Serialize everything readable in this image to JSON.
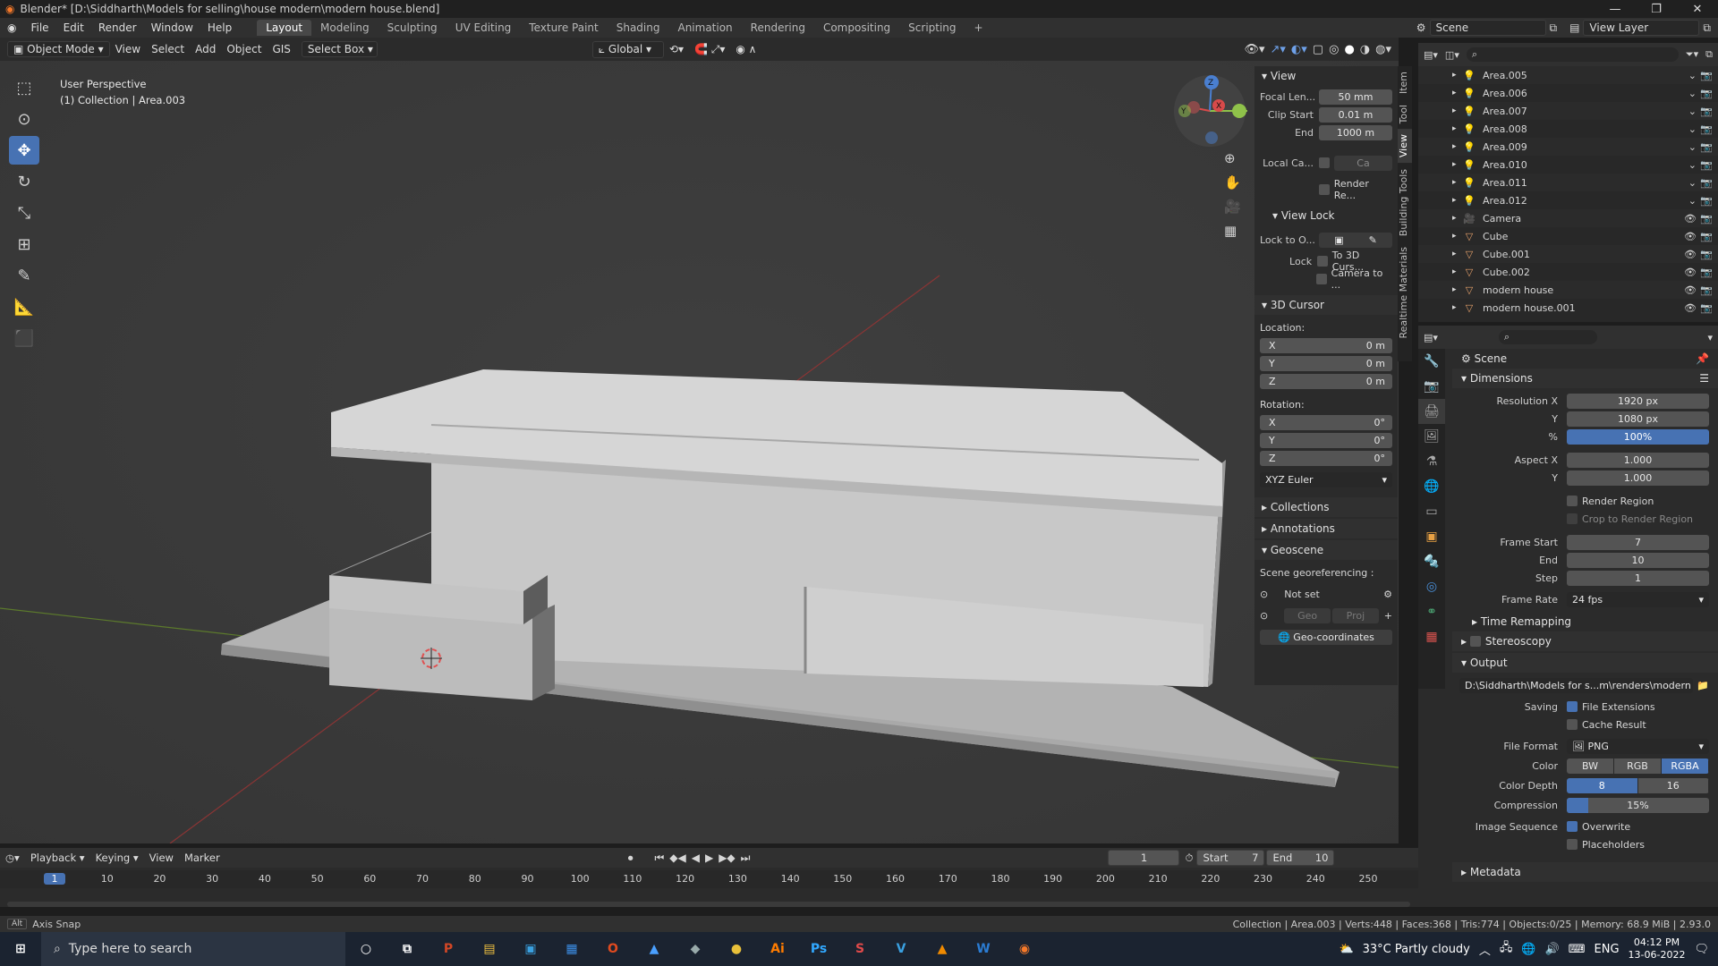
{
  "window": {
    "title": "Blender* [D:\\Siddharth\\Models for selling\\house modern\\modern house.blend]"
  },
  "menus": [
    "File",
    "Edit",
    "Render",
    "Window",
    "Help"
  ],
  "workspaces": [
    "Layout",
    "Modeling",
    "Sculpting",
    "UV Editing",
    "Texture Paint",
    "Shading",
    "Animation",
    "Rendering",
    "Compositing",
    "Scripting"
  ],
  "scene": {
    "label": "Scene",
    "view_layer": "View Layer"
  },
  "vp_header": {
    "mode": "Object Mode",
    "view": "View",
    "select": "Select",
    "add": "Add",
    "object": "Object",
    "gis": "GIS",
    "select_box": "Select Box",
    "orientation": "Global"
  },
  "vp_info": {
    "line1": "User Perspective",
    "line2": "(1) Collection | Area.003"
  },
  "npanel": {
    "view_header": "View",
    "focal_label": "Focal Len...",
    "focal": "50 mm",
    "clip_start_label": "Clip Start",
    "clip_start": "0.01 m",
    "end_label": "End",
    "end": "1000 m",
    "local_cam_label": "Local Ca...",
    "local_cam_val": "Ca",
    "render_region": "Render Re...",
    "view_lock": "View Lock",
    "lock_to": "Lock to O...",
    "lock": "Lock",
    "to_3d_cursor": "To 3D Curs...",
    "camera_to": "Camera to ...",
    "cursor_header": "3D Cursor",
    "location": "Location:",
    "x": "X",
    "y": "Y",
    "z": "Z",
    "loc_x": "0 m",
    "loc_y": "0 m",
    "loc_z": "0 m",
    "rotation": "Rotation:",
    "rot_x": "0°",
    "rot_y": "0°",
    "rot_z": "0°",
    "euler": "XYZ Euler",
    "collections": "Collections",
    "annotations": "Annotations",
    "geoscene": "Geoscene",
    "geo_label": "Scene georeferencing :",
    "not_set": "Not set",
    "geo": "Geo",
    "proj": "Proj",
    "geo_coords": "Geo-coordinates"
  },
  "ntabs": [
    "Item",
    "Tool",
    "View",
    "Building Tools",
    "Realtime Materials"
  ],
  "outliner": [
    {
      "name": "Area.005",
      "type": "light"
    },
    {
      "name": "Area.006",
      "type": "light"
    },
    {
      "name": "Area.007",
      "type": "light"
    },
    {
      "name": "Area.008",
      "type": "light"
    },
    {
      "name": "Area.009",
      "type": "light"
    },
    {
      "name": "Area.010",
      "type": "light"
    },
    {
      "name": "Area.011",
      "type": "light"
    },
    {
      "name": "Area.012",
      "type": "light"
    },
    {
      "name": "Camera",
      "type": "camera"
    },
    {
      "name": "Cube",
      "type": "mesh"
    },
    {
      "name": "Cube.001",
      "type": "mesh"
    },
    {
      "name": "Cube.002",
      "type": "mesh"
    },
    {
      "name": "modern house",
      "type": "mesh"
    },
    {
      "name": "modern house.001",
      "type": "mesh"
    }
  ],
  "props": {
    "scene": "Scene",
    "dimensions": "Dimensions",
    "res_x_label": "Resolution X",
    "res_x": "1920 px",
    "y_label": "Y",
    "res_y": "1080 px",
    "pct_label": "%",
    "pct": "100%",
    "aspect_x_label": "Aspect X",
    "aspect_x": "1.000",
    "aspect_y": "1.000",
    "render_region": "Render Region",
    "crop": "Crop to Render Region",
    "frame_start_label": "Frame Start",
    "frame_start": "7",
    "end_label": "End",
    "frame_end": "10",
    "step_label": "Step",
    "step": "1",
    "frame_rate_label": "Frame Rate",
    "frame_rate": "24 fps",
    "time_remap": "Time Remapping",
    "stereoscopy": "Stereoscopy",
    "output": "Output",
    "output_path": "D:\\Siddharth\\Models for s...m\\renders\\modern house",
    "saving": "Saving",
    "file_ext": "File Extensions",
    "cache": "Cache Result",
    "file_format_label": "File Format",
    "file_format": "PNG",
    "color_label": "Color",
    "bw": "BW",
    "rgb": "RGB",
    "rgba": "RGBA",
    "depth_label": "Color Depth",
    "d8": "8",
    "d16": "16",
    "compression_label": "Compression",
    "compression": "15%",
    "compression_fraction": 0.15,
    "img_seq": "Image Sequence",
    "overwrite": "Overwrite",
    "placeholders": "Placeholders",
    "metadata": "Metadata"
  },
  "timeline": {
    "playback": "Playback",
    "keying": "Keying",
    "view": "View",
    "marker": "Marker",
    "current": "1",
    "start_label": "Start",
    "start": "7",
    "end_label": "End",
    "end": "10",
    "ticks": [
      "1",
      "10",
      "20",
      "30",
      "40",
      "50",
      "60",
      "70",
      "80",
      "90",
      "100",
      "110",
      "120",
      "130",
      "140",
      "150",
      "160",
      "170",
      "180",
      "190",
      "200",
      "210",
      "220",
      "230",
      "240",
      "250"
    ]
  },
  "status": {
    "left": "Axis Snap",
    "right": "Collection | Area.003 | Verts:448 | Faces:368 | Tris:774 | Objects:0/25 | Memory: 68.9 MiB | 2.93.0"
  },
  "taskbar": {
    "search": "Type here to search",
    "weather": "33°C  Partly cloudy",
    "lang": "ENG",
    "time": "04:12 PM",
    "date": "13-06-2022",
    "apps": [
      {
        "label": "P",
        "color": "#d24726"
      },
      {
        "label": "▤",
        "color": "#f0c040"
      },
      {
        "label": "▣",
        "color": "#3aa0e0"
      },
      {
        "label": "▦",
        "color": "#3c8ee6"
      },
      {
        "label": "O",
        "color": "#e04a1f"
      },
      {
        "label": "▲",
        "color": "#4aa0ff"
      },
      {
        "label": "◆",
        "color": "#9aa"
      },
      {
        "label": "●",
        "color": "#e8c03a"
      },
      {
        "label": "Ai",
        "color": "#ff7c00"
      },
      {
        "label": "Ps",
        "color": "#31a8ff"
      },
      {
        "label": "S",
        "color": "#e04a4a"
      },
      {
        "label": "V",
        "color": "#3aa0e0"
      },
      {
        "label": "▲",
        "color": "#f08a00"
      },
      {
        "label": "W",
        "color": "#2b7cd3"
      },
      {
        "label": "◉",
        "color": "#f5792a"
      }
    ]
  }
}
